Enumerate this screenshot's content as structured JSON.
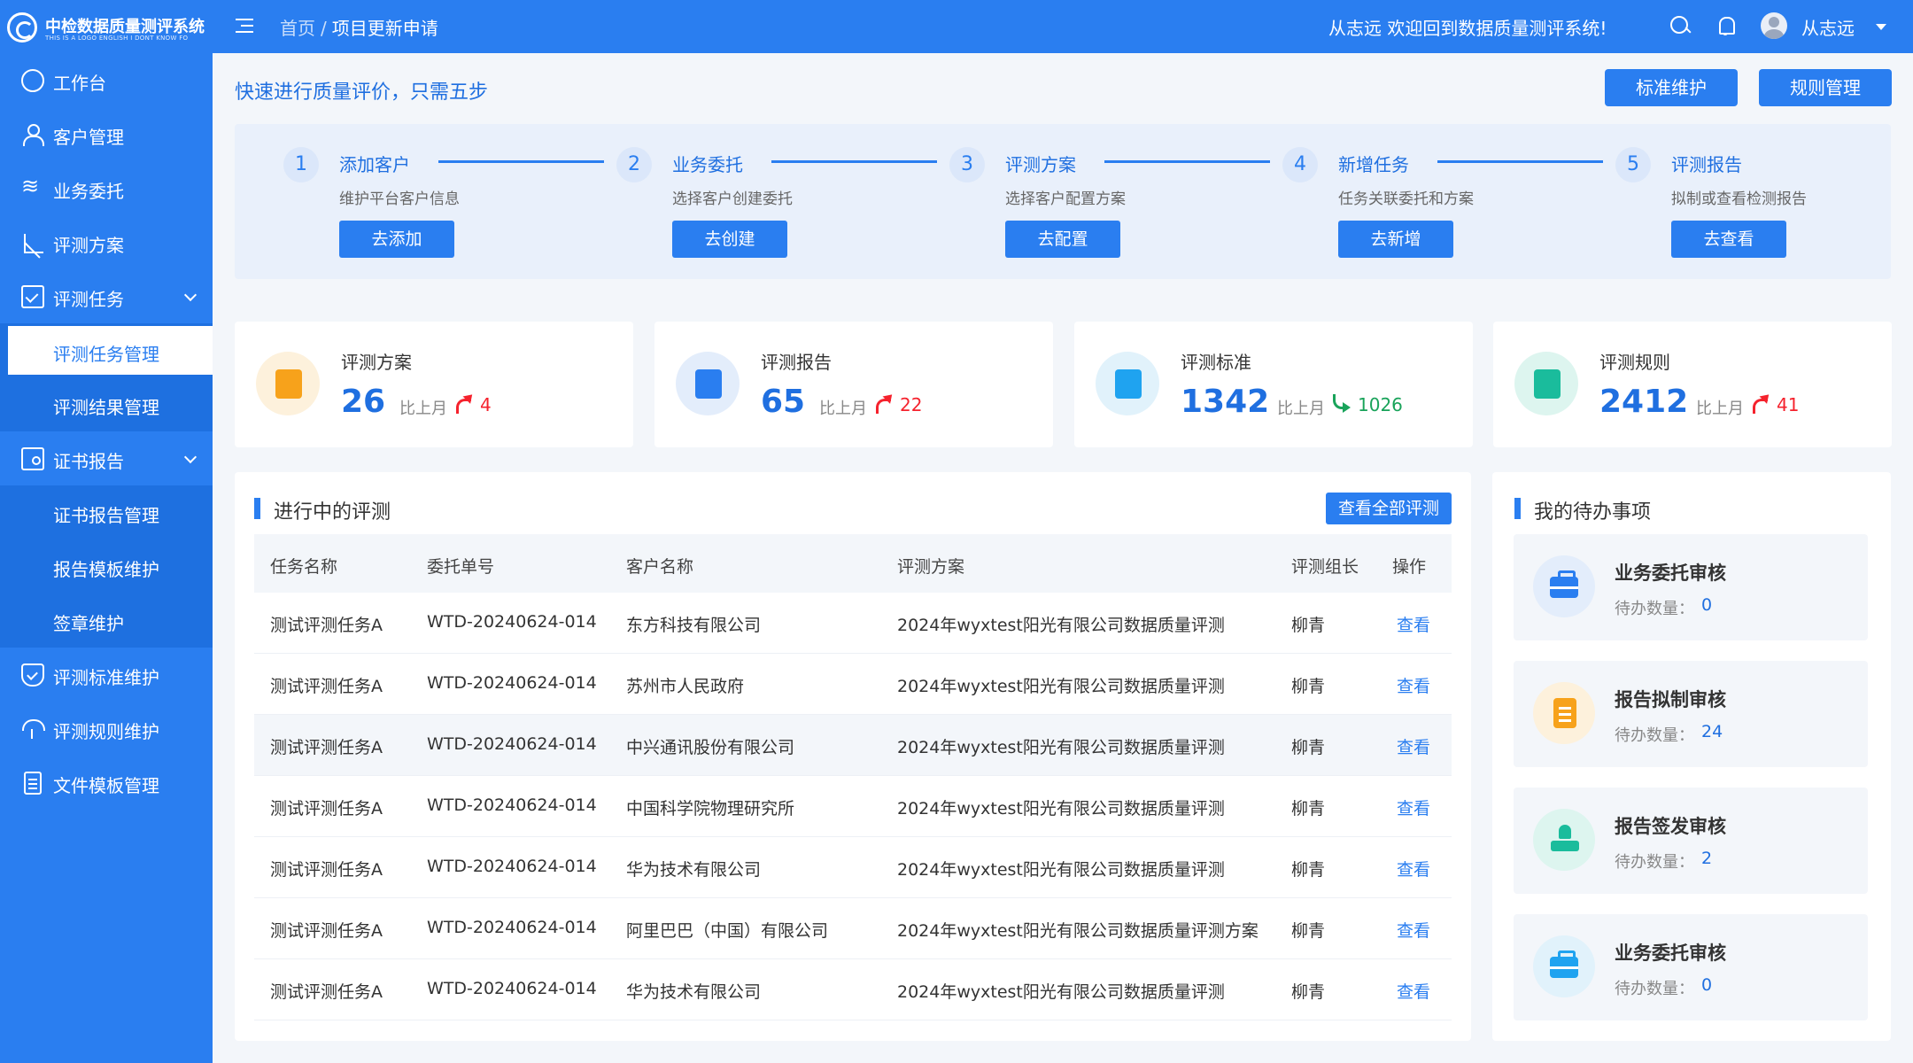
{
  "header": {
    "logo_title": "中检数据质量测评系统",
    "logo_subtitle": "THIS IS A LOGO ENGLISH I DONT KNOW FO",
    "breadcrumb_home": "首页",
    "breadcrumb_sep": "/",
    "breadcrumb_current": "项目更新申请",
    "welcome": "从志远  欢迎回到数据质量测评系统!",
    "user_name": "从志远"
  },
  "sidebar": {
    "items": [
      {
        "label": "工作台",
        "icon": "dashboard-icon"
      },
      {
        "label": "客户管理",
        "icon": "user-icon"
      },
      {
        "label": "业务委托",
        "icon": "wave-icon"
      },
      {
        "label": "评测方案",
        "icon": "ruler-icon"
      },
      {
        "label": "评测任务",
        "icon": "checkbox-icon"
      },
      {
        "label": "评测任务管理"
      },
      {
        "label": "评测结果管理"
      },
      {
        "label": "证书报告",
        "icon": "certificate-icon"
      },
      {
        "label": "证书报告管理"
      },
      {
        "label": "报告模板维护"
      },
      {
        "label": "签章维护"
      },
      {
        "label": "评测标准维护",
        "icon": "shield-icon"
      },
      {
        "label": "评测规则维护",
        "icon": "umbrella-icon"
      },
      {
        "label": "文件模板管理",
        "icon": "document-icon"
      }
    ]
  },
  "quick": {
    "title": "快速进行质量评价，只需五步",
    "btn_standard": "标准维护",
    "btn_rules": "规则管理",
    "steps": [
      {
        "num": "1",
        "title": "添加客户",
        "desc": "维护平台客户信息",
        "btn": "去添加"
      },
      {
        "num": "2",
        "title": "业务委托",
        "desc": "选择客户创建委托",
        "btn": "去创建"
      },
      {
        "num": "3",
        "title": "评测方案",
        "desc": "选择客户配置方案",
        "btn": "去配置"
      },
      {
        "num": "4",
        "title": "新增任务",
        "desc": "任务关联委托和方案",
        "btn": "去新增"
      },
      {
        "num": "5",
        "title": "评测报告",
        "desc": "拟制或查看检测报告",
        "btn": "去查看"
      }
    ]
  },
  "stats": [
    {
      "label": "评测方案",
      "value": "26",
      "cmp": "比上月",
      "delta": "4",
      "trend": "up",
      "color": "#f7a21b",
      "bg": "#fdf1dc"
    },
    {
      "label": "评测报告",
      "value": "65",
      "cmp": "比上月",
      "delta": "22",
      "trend": "up",
      "color": "#2a7ef0",
      "bg": "#e3edfb"
    },
    {
      "label": "评测标准",
      "value": "1342",
      "cmp": "比上月",
      "delta": "1026",
      "trend": "down",
      "color": "#1fa3f0",
      "bg": "#e1f2fb"
    },
    {
      "label": "评测规则",
      "value": "2412",
      "cmp": "比上月",
      "delta": "41",
      "trend": "up",
      "color": "#1abc9c",
      "bg": "#ddf5ef"
    }
  ],
  "table": {
    "title": "进行中的评测",
    "view_all": "查看全部评测",
    "columns": [
      "任务名称",
      "委托单号",
      "客户名称",
      "评测方案",
      "评测组长",
      "操作"
    ],
    "rows": [
      [
        "测试评测任务A",
        "WTD-20240624-014",
        "东方科技有限公司",
        "2024年wyxtest阳光有限公司数据质量评测",
        "柳青",
        "查看"
      ],
      [
        "测试评测任务A",
        "WTD-20240624-014",
        "苏州市人民政府",
        "2024年wyxtest阳光有限公司数据质量评测",
        "柳青",
        "查看"
      ],
      [
        "测试评测任务A",
        "WTD-20240624-014",
        "中兴通讯股份有限公司",
        "2024年wyxtest阳光有限公司数据质量评测",
        "柳青",
        "查看"
      ],
      [
        "测试评测任务A",
        "WTD-20240624-014",
        "中国科学院物理研究所",
        "2024年wyxtest阳光有限公司数据质量评测",
        "柳青",
        "查看"
      ],
      [
        "测试评测任务A",
        "WTD-20240624-014",
        "华为技术有限公司",
        "2024年wyxtest阳光有限公司数据质量评测",
        "柳青",
        "查看"
      ],
      [
        "测试评测任务A",
        "WTD-20240624-014",
        "阿里巴巴（中国）有限公司",
        "2024年wyxtest阳光有限公司数据质量评测方案",
        "柳青",
        "查看"
      ],
      [
        "测试评测任务A",
        "WTD-20240624-014",
        "华为技术有限公司",
        "2024年wyxtest阳光有限公司数据质量评测",
        "柳青",
        "查看"
      ]
    ]
  },
  "todo": {
    "title": "我的待办事项",
    "items": [
      {
        "title": "业务委托审核",
        "count_label": "待办数量：",
        "count": "0",
        "icon": "briefcase-icon",
        "color": "#2a7ef0",
        "bg": "#e3edfb"
      },
      {
        "title": "报告拟制审核",
        "count_label": "待办数量：",
        "count": "24",
        "icon": "report-icon",
        "color": "#f7a21b",
        "bg": "#fdf1dc"
      },
      {
        "title": "报告签发审核",
        "count_label": "待办数量：",
        "count": "2",
        "icon": "stamp-icon",
        "color": "#1abc9c",
        "bg": "#ddf5ef"
      },
      {
        "title": "业务委托审核",
        "count_label": "待办数量：",
        "count": "0",
        "icon": "briefcase-icon",
        "color": "#1fa3f0",
        "bg": "#e1f2fb"
      }
    ]
  }
}
